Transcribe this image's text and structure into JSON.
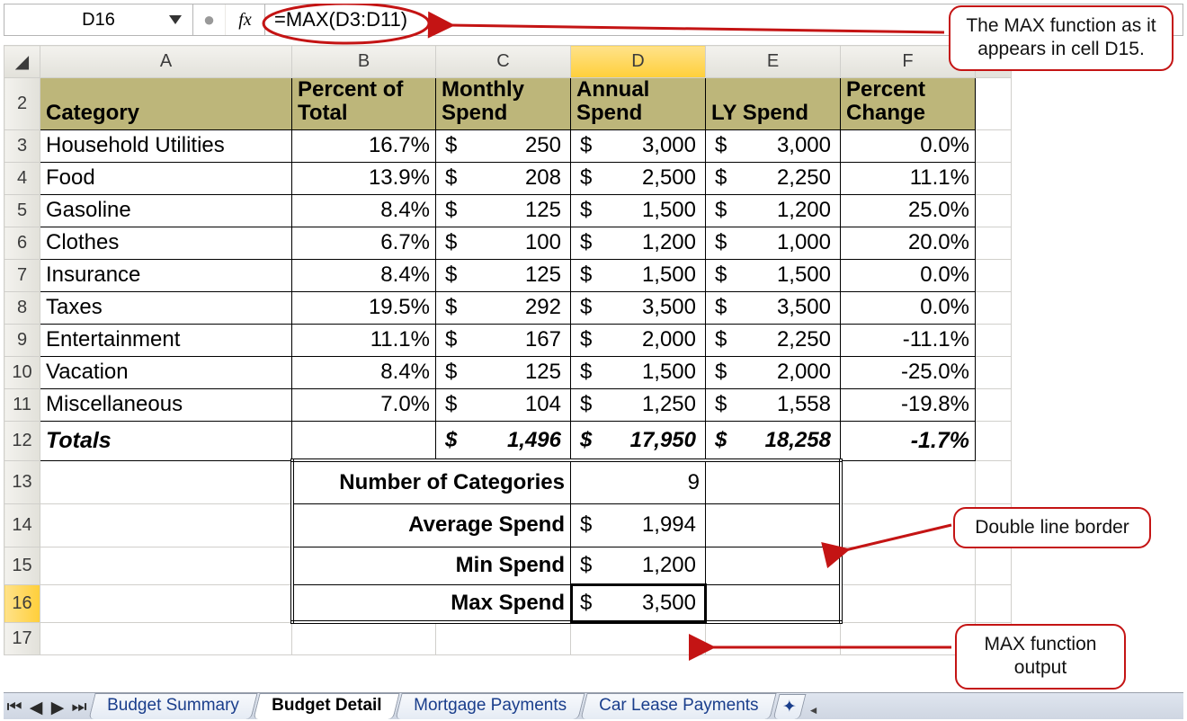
{
  "formula_bar": {
    "cell_ref": "D16",
    "fx_label": "fx",
    "formula": "=MAX(D3:D11)"
  },
  "columns": [
    "A",
    "B",
    "C",
    "D",
    "E",
    "F"
  ],
  "headers": {
    "A": "Category",
    "B": "Percent of Total",
    "C": "Monthly Spend",
    "D": "Annual Spend",
    "E": "LY Spend",
    "F": "Percent Change"
  },
  "rows": [
    {
      "r": 3,
      "cat": "Household Utilities",
      "pct": "16.7%",
      "mon": "250",
      "ann": "3,000",
      "ly": "3,000",
      "chg": "0.0%"
    },
    {
      "r": 4,
      "cat": "Food",
      "pct": "13.9%",
      "mon": "208",
      "ann": "2,500",
      "ly": "2,250",
      "chg": "11.1%"
    },
    {
      "r": 5,
      "cat": "Gasoline",
      "pct": "8.4%",
      "mon": "125",
      "ann": "1,500",
      "ly": "1,200",
      "chg": "25.0%"
    },
    {
      "r": 6,
      "cat": "Clothes",
      "pct": "6.7%",
      "mon": "100",
      "ann": "1,200",
      "ly": "1,000",
      "chg": "20.0%"
    },
    {
      "r": 7,
      "cat": "Insurance",
      "pct": "8.4%",
      "mon": "125",
      "ann": "1,500",
      "ly": "1,500",
      "chg": "0.0%"
    },
    {
      "r": 8,
      "cat": "Taxes",
      "pct": "19.5%",
      "mon": "292",
      "ann": "3,500",
      "ly": "3,500",
      "chg": "0.0%"
    },
    {
      "r": 9,
      "cat": "Entertainment",
      "pct": "11.1%",
      "mon": "167",
      "ann": "2,000",
      "ly": "2,250",
      "chg": "-11.1%"
    },
    {
      "r": 10,
      "cat": "Vacation",
      "pct": "8.4%",
      "mon": "125",
      "ann": "1,500",
      "ly": "2,000",
      "chg": "-25.0%"
    },
    {
      "r": 11,
      "cat": "Miscellaneous",
      "pct": "7.0%",
      "mon": "104",
      "ann": "1,250",
      "ly": "1,558",
      "chg": "-19.8%"
    }
  ],
  "totals": {
    "label": "Totals",
    "mon": "1,496",
    "ann": "17,950",
    "ly": "18,258",
    "chg": "-1.7%"
  },
  "summary": {
    "num_label": "Number of Categories",
    "num_val": "9",
    "avg_label": "Average Spend",
    "avg_val": "1,994",
    "min_label": "Min Spend",
    "min_val": "1,200",
    "max_label": "Max Spend",
    "max_val": "3,500"
  },
  "tabs": [
    "Budget Summary",
    "Budget Detail",
    "Mortgage Payments",
    "Car Lease Payments"
  ],
  "active_tab": 1,
  "callouts": {
    "top": "The MAX function as it appears in cell D15.",
    "mid": "Double line border",
    "bot": "MAX function output"
  },
  "currency": "$"
}
